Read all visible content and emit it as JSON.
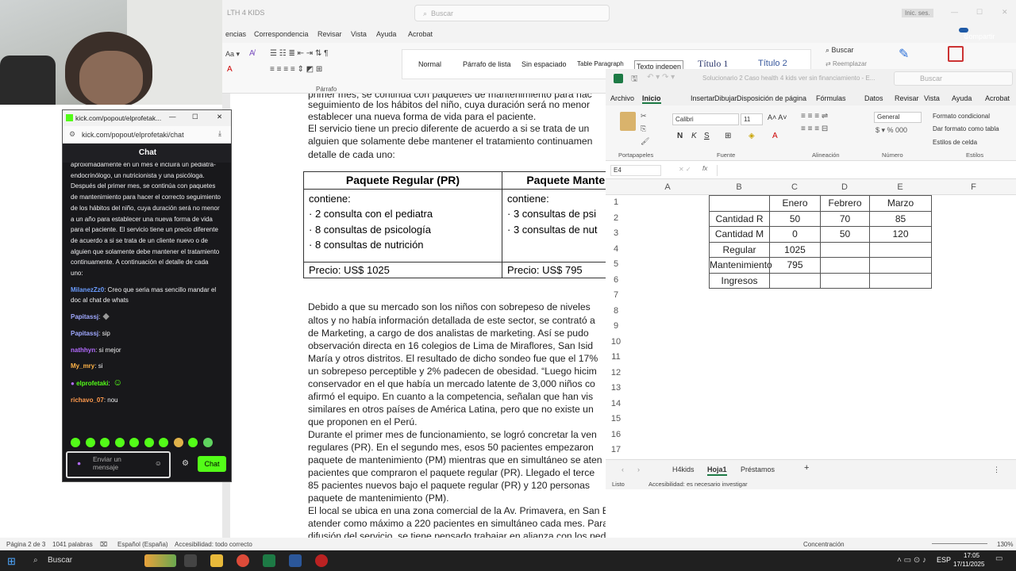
{
  "word": {
    "title_fragment": "LTH 4 KIDS",
    "search_placeholder": "Buscar",
    "session_badge": "Inic. ses.",
    "share_button": "Compartir",
    "tabs": [
      "encias",
      "Correspondencia",
      "Revisar",
      "Vista",
      "Ayuda",
      "Acrobat"
    ],
    "styles": [
      "Normal",
      "Párrafo de lista",
      "Sin espaciado",
      "Table Paragraph",
      "Texto indepen",
      "Título 1",
      "Título 2"
    ],
    "paragraph_group": "Párrafo",
    "buscar": "Buscar",
    "reemplazar": "Reemplazar",
    "body_top": [
      "primer mes, se continúa con paquetes de mantenimiento para hac",
      "seguimiento de los hábitos del niño, cuya duración será no menor",
      "establecer una nueva forma de vida para el paciente.",
      "El servicio tiene un precio diferente de acuerdo a si se trata de un",
      "alguien que solamente debe mantener el tratamiento continuamen",
      "detalle de cada uno:"
    ],
    "table": {
      "headers": [
        "Paquete Regular (PR)",
        "Paquete Manten"
      ],
      "contains": [
        "contiene:",
        "contiene:"
      ],
      "regular_items": [
        "· 2 consulta con el pediatra",
        "· 8 consultas de psicología",
        "· 8 consultas de nutrición"
      ],
      "maint_items": [
        "· 3 consultas de psi",
        "· 3 consultas de nut"
      ],
      "prices": [
        "Precio: US$ 1025",
        "Precio: US$ 795"
      ]
    },
    "body_bottom": [
      "Debido a que su mercado son los niños con sobrepeso de niveles",
      "altos y no había información detallada de este sector, se contrató a",
      "de Marketing, a cargo de dos analistas de marketing. Así se pudo",
      "observación directa en 16 colegios de Lima de Miraflores, San Isid",
      "María y otros distritos. El resultado de dicho sondeo fue que el 17%",
      "un sobrepeso perceptible y 2% padecen de obesidad. “Luego hicim",
      "conservador en el que había un mercado latente de 3,000 niños co",
      "afirmó el equipo. En cuanto a la competencia, señalan que han vis",
      "similares en otros países de América Latina, pero que no existe un",
      "que proponen en el Perú.",
      "Durante el primer mes de funcionamiento, se logró concretar la ven",
      "regulares (PR). En el segundo mes, esos 50 pacientes empezaron",
      "paquete de mantenimiento (PM) mientras que en simultáneo se aten",
      "pacientes que compraron el paquete regular (PR). Llegado el terce",
      "85 pacientes nuevos bajo el paquete regular (PR) y 120 personas",
      "paquete de mantenimiento (PM).",
      "El local se ubica en una zona comercial de la Av. Primavera, en San Borja, y puede",
      "atender como máximo a 220 pacientes en simultáneo cada mes. Para realizar la",
      "difusión del servicio, se tiene pensado trabajar en alianza con los pediatras de diversos",
      "hospitales. Por otro lado, también proponen brindar charlas a los profesores estables"
    ],
    "status": {
      "page": "Página 2 de 3",
      "words": "1041 palabras",
      "language": "Español (España)",
      "accessibility": "Accesibilidad: todo correcto",
      "focus": "Concentración",
      "zoom": "130%"
    }
  },
  "excel": {
    "title": "Solucionario 2 Caso health 4 kids ver sin financiamiento - E...",
    "search_placeholder": "Buscar",
    "tabs": [
      "Archivo",
      "Inicio",
      "Insertar",
      "Dibujar",
      "Disposición de página",
      "Fórmulas",
      "Datos",
      "Revisar",
      "Vista",
      "Ayuda",
      "Acrobat"
    ],
    "active_tab": "Inicio",
    "ribbon": {
      "font_name": "Calibri",
      "font_size": "11",
      "number_format": "General",
      "cond_format": "Formato condicional",
      "table_format": "Dar formato como tabla",
      "cell_styles": "Estilos de celda",
      "groups": [
        "Portapapeles",
        "Fuente",
        "Alineación",
        "Número",
        "Estilos"
      ]
    },
    "name_box": "E4",
    "fx": "fx",
    "columns": [
      "A",
      "B",
      "C",
      "D",
      "E",
      "F"
    ],
    "rows": [
      "1",
      "2",
      "3",
      "4",
      "5",
      "6",
      "7",
      "8",
      "9",
      "10",
      "11",
      "12",
      "13",
      "14",
      "15",
      "16",
      "17"
    ],
    "table": {
      "header": [
        "",
        "Enero",
        "Febrero",
        "Marzo"
      ],
      "rows": [
        [
          "Cantidad R",
          "50",
          "70",
          "85"
        ],
        [
          "Cantidad M",
          "0",
          "50",
          "120"
        ],
        [
          "Regular",
          "1025",
          "",
          ""
        ],
        [
          "Mantenimiento",
          "795",
          "",
          ""
        ],
        [
          "Ingresos",
          "",
          "",
          ""
        ]
      ]
    },
    "sheets": [
      "H4kids",
      "Hoja1",
      "Préstamos"
    ],
    "active_sheet": "Hoja1",
    "status_ready": "Listo",
    "status_access": "Accesibilidad: es necesario investigar"
  },
  "chat": {
    "window_title": "kick.com/popout/elprofetak...",
    "url": "kick.com/popout/elprofetaki/chat",
    "header": "Chat",
    "intro": "aproximadamente en un mes e incluirá un pediatra-endocrinólogo, un nutricionista y una psicóloga. Después del primer mes, se continúa con paquetes de mantenimiento para hacer el correcto seguimiento de los hábitos del niño, cuya duración será no menor a un año para establecer una nueva forma de vida para el paciente. El servicio tiene un precio diferente de acuerdo a si se trata de un cliente nuevo o de alguien que solamente debe mantener el tratamiento continuamente. A continuación el detalle de cada uno:",
    "messages": [
      {
        "user": "MilanezZz0",
        "color": "#6a9cff",
        "text": ": Creo que seria mas sencillo mandar el doc al chat de whats"
      },
      {
        "user": "Papitassj",
        "color": "#9fa8ff",
        "text": ":"
      },
      {
        "user": "Papitassj",
        "color": "#9fa8ff",
        "text": ": sip"
      },
      {
        "user": "nathhyn",
        "color": "#b36bff",
        "text": ": si mejor"
      },
      {
        "user": "My_mry",
        "color": "#ffb347",
        "text": ": si"
      },
      {
        "user": "elprofetaki",
        "color": "#53fc18",
        "text": ":"
      },
      {
        "user": "richavo_07",
        "color": "#ff9a4d",
        "text": ": nou"
      }
    ],
    "input_placeholder": "Enviar un mensaje",
    "send_button": "Chat",
    "accent": "#53fc18"
  },
  "taskbar": {
    "search": "Buscar",
    "language": "ESP",
    "time": "17:05",
    "date": "17/11/2025"
  }
}
